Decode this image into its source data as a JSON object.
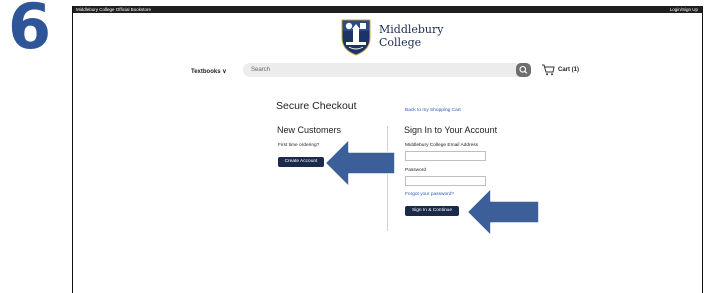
{
  "step_number": "6",
  "topbar": {
    "left_text": "Middlebury College Official Bookstore",
    "right_text": "Login/Sign Up"
  },
  "logo": {
    "college_line1": "Middlebury",
    "college_line2": "College"
  },
  "nav": {
    "textbooks_label": "Textbooks ∨",
    "search_placeholder": "Search",
    "cart_label": "Cart (1)"
  },
  "checkout": {
    "title": "Secure Checkout",
    "back_link": "Back to my Shopping Cart",
    "new_customers": {
      "heading": "New Customers",
      "prompt": "First time ordering?",
      "create_button": "Create Account"
    },
    "sign_in": {
      "heading": "Sign In to Your Account",
      "email_label": "Middlebury College Email Address",
      "email_value": "",
      "password_label": "Password",
      "password_value": "",
      "forgot_link": "Forgot your password?",
      "submit_button": "Sign In & Continue"
    }
  },
  "colors": {
    "step_blue": "#2e5597",
    "button_navy": "#1b2a4a",
    "arrow_blue": "#3d5f99",
    "link_blue": "#2a59b5"
  },
  "icons": [
    "search-icon",
    "cart-icon",
    "college-shield-logo",
    "arrow-pointer"
  ]
}
